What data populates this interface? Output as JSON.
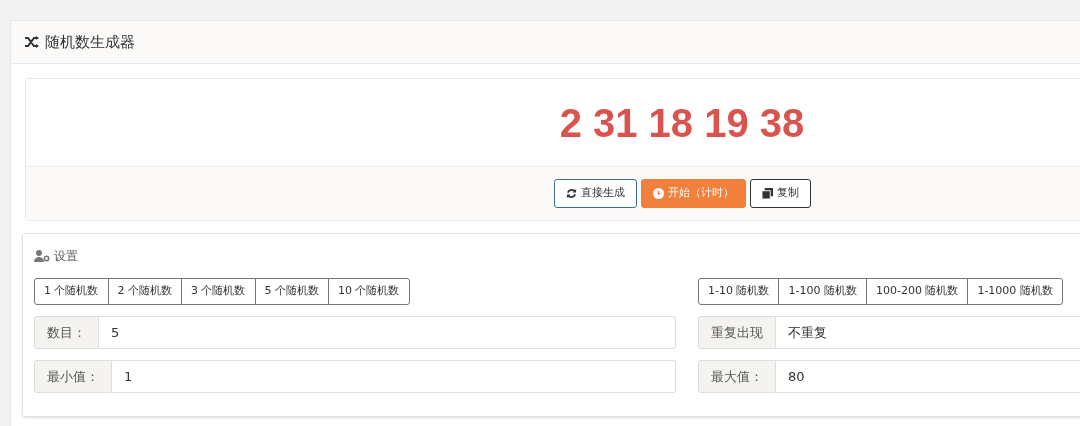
{
  "panel": {
    "title": "随机数生成器"
  },
  "result": {
    "numbers": "2 31 18 19 38"
  },
  "actions": [
    {
      "kind": "outline",
      "label": "直接生成"
    },
    {
      "kind": "primary",
      "label": "开始（计时）"
    },
    {
      "kind": "dark",
      "label": "复制"
    }
  ],
  "settings": {
    "title": "设置",
    "count_presets": [
      "1 个随机数",
      "2 个随机数",
      "3 个随机数",
      "5 个随机数",
      "10 个随机数"
    ],
    "range_presets": [
      "1-10 随机数",
      "1-100 随机数",
      "100-200 随机数",
      "1-1000 随机数"
    ],
    "fields": [
      {
        "label": "数目：",
        "value": "5"
      },
      {
        "label": "重复出现",
        "value": "不重复"
      },
      {
        "label": "最小值：",
        "value": "1"
      },
      {
        "label": "最大值：",
        "value": "80"
      }
    ]
  }
}
